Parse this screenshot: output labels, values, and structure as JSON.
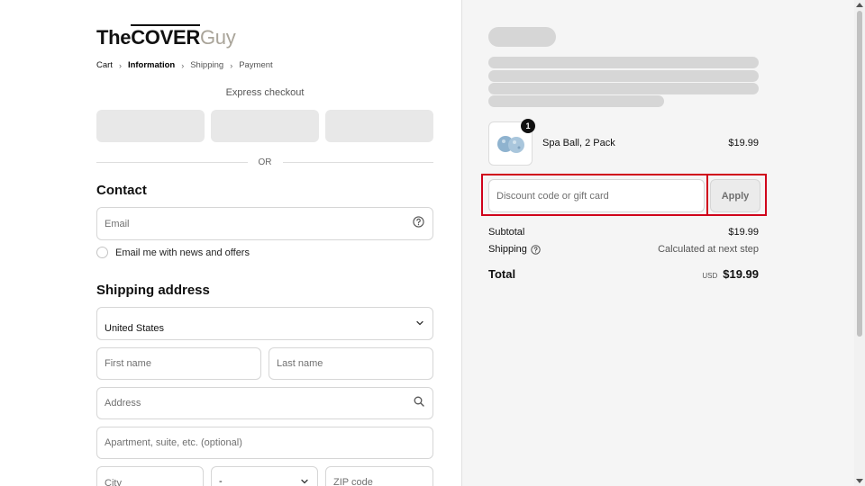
{
  "logo": {
    "part1": "The",
    "part2": "COVER",
    "part3": "Guy"
  },
  "breadcrumb": {
    "cart": "Cart",
    "information": "Information",
    "shipping": "Shipping",
    "payment": "Payment"
  },
  "express": {
    "label": "Express checkout",
    "or": "OR"
  },
  "contact": {
    "title": "Contact",
    "email_placeholder": "Email",
    "newsletter_label": "Email me with news and offers"
  },
  "shipping": {
    "title": "Shipping address",
    "country_value": "United States",
    "first_name_placeholder": "First name",
    "last_name_placeholder": "Last name",
    "address_placeholder": "Address",
    "apartment_placeholder": "Apartment, suite, etc. (optional)",
    "city_placeholder": "City",
    "state_value": "-",
    "zip_placeholder": "ZIP code"
  },
  "cart": {
    "item": {
      "name": "Spa Ball, 2 Pack",
      "price": "$19.99",
      "quantity": "1"
    },
    "discount_placeholder": "Discount code or gift card",
    "apply_label": "Apply",
    "subtotal_label": "Subtotal",
    "subtotal_value": "$19.99",
    "shipping_label": "Shipping",
    "shipping_value": "Calculated at next step",
    "total_label": "Total",
    "total_currency": "USD",
    "total_value": "$19.99"
  },
  "colors": {
    "highlight": "#d0021b",
    "skeleton": "#d6d6d6",
    "logo_accent": "#a9a499"
  },
  "icons": {
    "help": "question-circle-icon",
    "search": "search-icon",
    "chevron": "chevron-down-icon"
  }
}
